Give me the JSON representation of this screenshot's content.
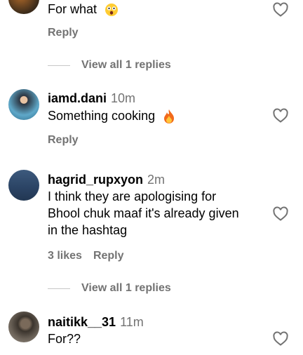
{
  "comments": [
    {
      "text": "For what",
      "emoji_icon": "flushed-face-emoji",
      "reply_label": "Reply",
      "view_replies": "View all 1 replies"
    },
    {
      "username": "iamd.dani",
      "time": "10m",
      "text": "Something cooking",
      "emoji_icon": "fire-emoji",
      "reply_label": "Reply"
    },
    {
      "username": "hagrid_rupxyon",
      "time": "2m",
      "text_lines": [
        "I think they are apologising for",
        "Bhool chuk maaf it's already given",
        "in the hashtag"
      ],
      "likes": "3 likes",
      "reply_label": "Reply",
      "view_replies": "View all 1 replies"
    },
    {
      "username": "naitikk__31",
      "time": "11m",
      "text": "For??"
    }
  ],
  "colors": {
    "secondary_text": "#737373",
    "heart_outline": "#737373"
  }
}
